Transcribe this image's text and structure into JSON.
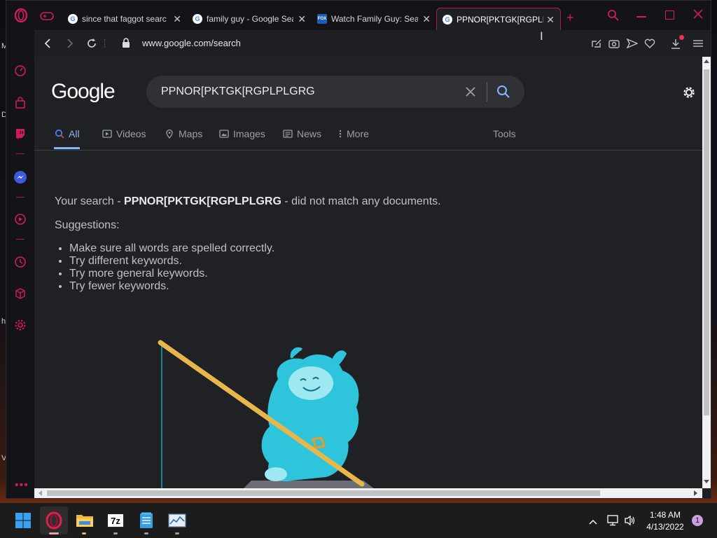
{
  "desktop": {
    "edge_labels": [
      "M",
      "D",
      "h",
      "V"
    ]
  },
  "browser": {
    "tabs": [
      {
        "title": "since that faggot searc",
        "favicon": "google-g-icon"
      },
      {
        "title": "family guy - Google Sea",
        "favicon": "google-g-icon"
      },
      {
        "title": "Watch Family Guy: Seas",
        "favicon": "fox-icon",
        "favicon_text": "FOX"
      },
      {
        "title": "PPNOR[PKTGK[RGPLPLG",
        "favicon": "google-g-icon",
        "active": true
      }
    ],
    "url": "www.google.com/search",
    "accent": "#b0145a"
  },
  "google": {
    "logo": "Google",
    "query": "PPNOR[PKTGK[RGPLPLGRG",
    "nav": [
      {
        "label": "All",
        "active": true
      },
      {
        "label": "Videos"
      },
      {
        "label": "Maps"
      },
      {
        "label": "Images"
      },
      {
        "label": "News"
      },
      {
        "label": "More"
      }
    ],
    "tools": "Tools",
    "result": {
      "prefix": "Your search - ",
      "term": "PPNOR[PKTGK[RGPLPLGRG",
      "suffix": " - did not match any documents.",
      "suggestions_label": "Suggestions:",
      "suggestions": [
        "Make sure all words are spelled correctly.",
        "Try different keywords.",
        "Try more general keywords.",
        "Try fewer keywords."
      ]
    }
  },
  "taskbar": {
    "apps": [
      "windows-start-icon",
      "opera-icon",
      "file-explorer-icon",
      "7zip-icon",
      "notepad-icon",
      "task-manager-icon"
    ],
    "app_7z_label": "7z",
    "time": "1:48 AM",
    "date": "4/13/2022",
    "notification_count": "1"
  }
}
